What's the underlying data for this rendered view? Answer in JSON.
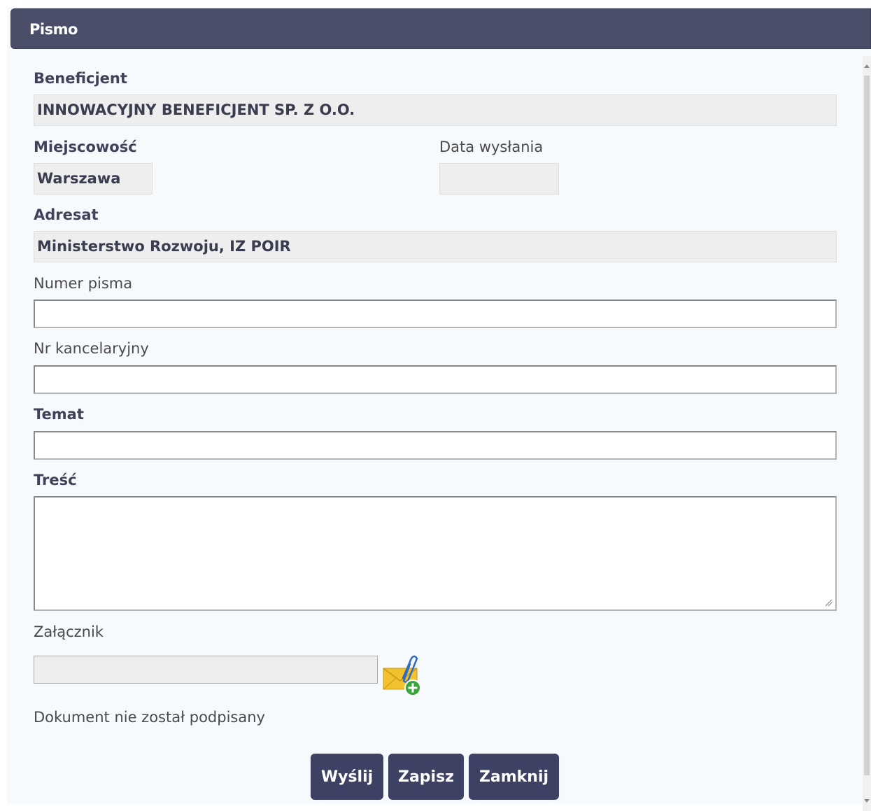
{
  "dialog": {
    "title": "Pismo"
  },
  "form": {
    "beneficjent_label": "Beneficjent",
    "beneficjent_value": "INNOWACYJNY BENEFICJENT SP. Z O.O.",
    "miejscowosc_label": "Miejscowość",
    "miejscowosc_value": "Warszawa",
    "data_wyslania_label": "Data wysłania",
    "data_wyslania_value": "",
    "adresat_label": "Adresat",
    "adresat_value": "Ministerstwo Rozwoju, IZ POIR",
    "numer_pisma_label": "Numer pisma",
    "numer_pisma_value": "",
    "nr_kancelaryjny_label": "Nr kancelaryjny",
    "nr_kancelaryjny_value": "",
    "temat_label": "Temat",
    "temat_value": "",
    "tresc_label": "Treść",
    "tresc_value": "",
    "zalacznik_label": "Załącznik",
    "zalacznik_value": "",
    "attach_icon": "envelope-paperclip-add-icon",
    "status_text": "Dokument nie został podpisany"
  },
  "buttons": {
    "send": "Wyślij",
    "save": "Zapisz",
    "close": "Zamknij"
  },
  "colors": {
    "header_bg": "#4a4e69",
    "button_bg": "#3d4163",
    "readonly_bg": "#eeeeee"
  }
}
